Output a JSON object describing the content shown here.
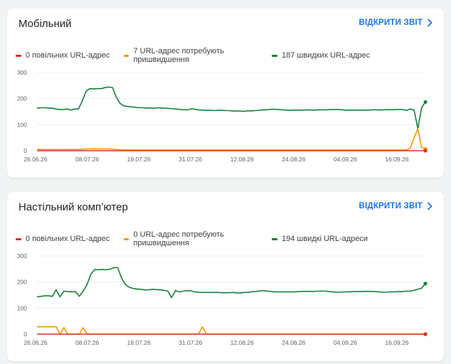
{
  "cards": [
    {
      "title": "Мобільний",
      "report_link": "ВІДКРИТИ ЗВІТ",
      "legend": [
        {
          "label": "0 повільних URL-адрес",
          "color": "#d93025"
        },
        {
          "label": "7 URL-адрес потребують пришвидшення",
          "color": "#f29900"
        },
        {
          "label": "187 швидких URL-адрес",
          "color": "#188038"
        }
      ],
      "chart_data": {
        "type": "line",
        "x_labels": [
          "26.06.26",
          "08.07.26",
          "19.07.26",
          "31.07.26",
          "12.08.26",
          "24.08.26",
          "04.09.26",
          "16.09.26"
        ],
        "ylim": [
          0,
          300
        ],
        "y_ticks": [
          0,
          100,
          200,
          300
        ],
        "grid": true,
        "series": [
          {
            "color": "#188038",
            "values": [
              163,
              165,
              165,
              164,
              163,
              160,
              158,
              158,
              160,
              156,
              160,
              160,
              190,
              228,
              238,
              237,
              238,
              238,
              242,
              244,
              243,
              207,
              182,
              172,
              170,
              168,
              167,
              165,
              165,
              164,
              164,
              163,
              165,
              164,
              163,
              162,
              161,
              160,
              158,
              157,
              157,
              161,
              159,
              156,
              156,
              155,
              155,
              154,
              155,
              155,
              154,
              154,
              152,
              153,
              152,
              151,
              153,
              153,
              154,
              155,
              157,
              157,
              159,
              159,
              158,
              157,
              156,
              155,
              156,
              156,
              156,
              156,
              157,
              156,
              156,
              157,
              157,
              157,
              158,
              158,
              158,
              157,
              155,
              156,
              156,
              156,
              156,
              156,
              156,
              157,
              157,
              156,
              157,
              158,
              157,
              158,
              158,
              158,
              155,
              160,
              156,
              85,
              165,
              187
            ]
          },
          {
            "color": "#f29900",
            "values": [
              5,
              5,
              5,
              5,
              5,
              5,
              5,
              5,
              5,
              5,
              5,
              5,
              6,
              7,
              7,
              7,
              7,
              7,
              7,
              7,
              6,
              5,
              4,
              3,
              3,
              3,
              3,
              3,
              3,
              3,
              3,
              3,
              3,
              3,
              3,
              3,
              3,
              3,
              3,
              3,
              3,
              3,
              3,
              3,
              3,
              3,
              3,
              3,
              3,
              3,
              3,
              3,
              3,
              3,
              3,
              3,
              3,
              3,
              3,
              3,
              3,
              3,
              3,
              3,
              3,
              3,
              3,
              3,
              3,
              3,
              3,
              3,
              3,
              3,
              3,
              3,
              3,
              3,
              3,
              3,
              3,
              3,
              3,
              3,
              3,
              3,
              3,
              3,
              3,
              3,
              3,
              3,
              3,
              3,
              3,
              3,
              3,
              3,
              3,
              10,
              50,
              85,
              12,
              7
            ]
          },
          {
            "color": "#d93025",
            "values": [
              0,
              0,
              0,
              0,
              0,
              0,
              0,
              0,
              0,
              0,
              0,
              0,
              0,
              0,
              0,
              0,
              0,
              0,
              0,
              0,
              0,
              0,
              0,
              0,
              0,
              0,
              0,
              0,
              0,
              0,
              0,
              0,
              0,
              0,
              0,
              0,
              0,
              0,
              0,
              0,
              0,
              0,
              0,
              0,
              0,
              0,
              0,
              0,
              0,
              0,
              0,
              0,
              0,
              0,
              0,
              0,
              0,
              0,
              0,
              0,
              0,
              0,
              0,
              0,
              0,
              0,
              0,
              0,
              0,
              0,
              0,
              0,
              0,
              0,
              0,
              0,
              0,
              0,
              0,
              0,
              0,
              0,
              0,
              0,
              0,
              0,
              0,
              0,
              0,
              0,
              0,
              0,
              0,
              0,
              0,
              0,
              0,
              0,
              0,
              0,
              0,
              0,
              0,
              0
            ]
          }
        ]
      }
    },
    {
      "title": "Настільний комп’ютер",
      "report_link": "ВІДКРИТИ ЗВІТ",
      "legend": [
        {
          "label": "0 повільних URL-адрес",
          "color": "#d93025"
        },
        {
          "label": "0 URL-адрес потребують пришвидшення",
          "color": "#f29900"
        },
        {
          "label": "194 швидкі URL-адреси",
          "color": "#188038"
        }
      ],
      "chart_data": {
        "type": "line",
        "x_labels": [
          "26.06.26",
          "08.07.26",
          "19.07.26",
          "31.07.26",
          "12.08.26",
          "24.08.26",
          "04.09.26",
          "16.09.26"
        ],
        "ylim": [
          0,
          300
        ],
        "y_ticks": [
          0,
          100,
          200,
          300
        ],
        "grid": true,
        "series": [
          {
            "color": "#188038",
            "values": [
              143,
              145,
              147,
              147,
              145,
              170,
              143,
              165,
              163,
              162,
              163,
              145,
              165,
              190,
              230,
              248,
              247,
              248,
              247,
              249,
              255,
              255,
              215,
              190,
              180,
              175,
              173,
              172,
              170,
              170,
              172,
              171,
              170,
              168,
              165,
              140,
              167,
              162,
              165,
              167,
              166,
              162,
              161,
              160,
              160,
              160,
              160,
              160,
              159,
              159,
              159,
              160,
              158,
              158,
              160,
              160,
              163,
              163,
              166,
              166,
              165,
              163,
              162,
              162,
              162,
              162,
              162,
              162,
              163,
              164,
              164,
              164,
              164,
              165,
              165,
              165,
              163,
              162,
              161,
              161,
              162,
              162,
              163,
              163,
              163,
              164,
              164,
              164,
              163,
              162,
              161,
              161,
              162,
              162,
              163,
              163,
              165,
              165,
              168,
              172,
              176,
              194
            ]
          },
          {
            "color": "#f29900",
            "values": [
              28,
              28,
              28,
              28,
              28,
              28,
              0,
              25,
              0,
              0,
              0,
              0,
              25,
              0,
              0,
              0,
              0,
              0,
              0,
              0,
              0,
              0,
              0,
              0,
              0,
              0,
              0,
              0,
              0,
              0,
              0,
              0,
              0,
              0,
              0,
              0,
              0,
              0,
              0,
              0,
              0,
              0,
              0,
              28,
              0,
              0,
              0,
              0,
              0,
              0,
              0,
              0,
              0,
              0,
              0,
              0,
              0,
              0,
              0,
              0,
              0,
              0,
              0,
              0,
              0,
              0,
              0,
              0,
              0,
              0,
              0,
              0,
              0,
              0,
              0,
              0,
              0,
              0,
              0,
              0,
              0,
              0,
              0,
              0,
              0,
              0,
              0,
              0,
              0,
              0,
              0,
              0,
              0,
              0,
              0,
              0,
              0,
              0,
              0,
              0,
              0,
              0
            ]
          },
          {
            "color": "#d93025",
            "values": [
              0,
              0,
              0,
              0,
              0,
              0,
              0,
              0,
              0,
              0,
              0,
              0,
              0,
              0,
              0,
              0,
              0,
              0,
              0,
              0,
              0,
              0,
              0,
              0,
              0,
              0,
              0,
              0,
              0,
              0,
              0,
              0,
              0,
              0,
              0,
              0,
              0,
              0,
              0,
              0,
              0,
              0,
              0,
              0,
              0,
              0,
              0,
              0,
              0,
              0,
              0,
              0,
              0,
              0,
              0,
              0,
              0,
              0,
              0,
              0,
              0,
              0,
              0,
              0,
              0,
              0,
              0,
              0,
              0,
              0,
              0,
              0,
              0,
              0,
              0,
              0,
              0,
              0,
              0,
              0,
              0,
              0,
              0,
              0,
              0,
              0,
              0,
              0,
              0,
              0,
              0,
              0,
              0,
              0,
              0,
              0,
              0,
              0,
              0,
              0,
              0,
              0
            ]
          }
        ]
      }
    }
  ]
}
